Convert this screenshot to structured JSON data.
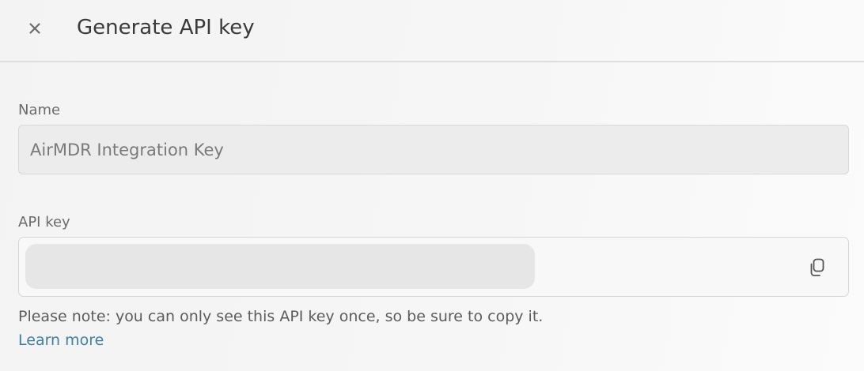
{
  "dialog": {
    "title": "Generate API key",
    "close_icon": "close-icon"
  },
  "name_field": {
    "label": "Name",
    "value": "AirMDR Integration Key"
  },
  "api_key_field": {
    "label": "API key",
    "copy_icon": "copy-icon"
  },
  "note": {
    "text": "Please note: you can only see this API key once, so be sure to copy it.",
    "link_label": "Learn more"
  },
  "colors": {
    "link": "#3f7ea6",
    "background": "#f4f4f4",
    "field_disabled": "#ececec"
  }
}
